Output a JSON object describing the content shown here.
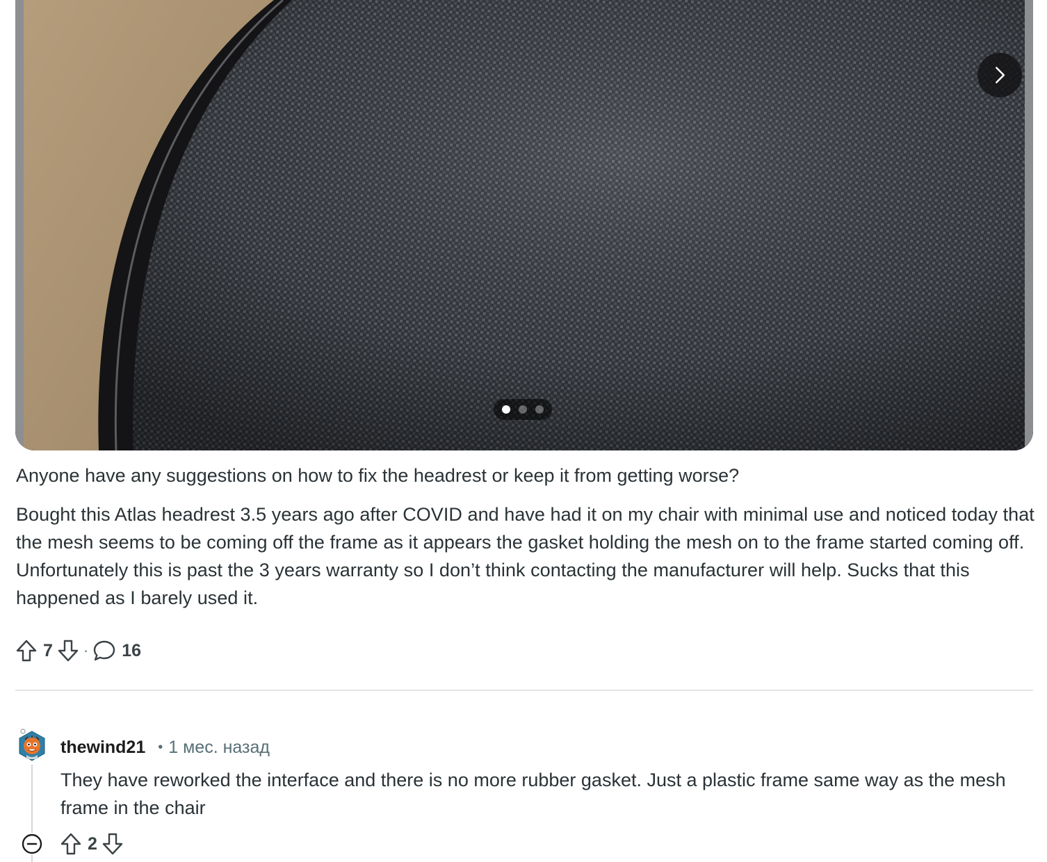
{
  "carousel": {
    "image_alt": "Close-up photo of a dark mesh headrest with its frame",
    "slide_count": 3,
    "active_slide": 1,
    "next_icon": "chevron-right-icon"
  },
  "post": {
    "title": "Anyone have any suggestions on how to fix the headrest or keep it from getting worse?",
    "body": "Bought this Atlas headrest 3.5 years ago after COVID and have had it on my chair with minimal use and noticed today that the mesh seems to be coming off the frame as it appears the gasket holding the mesh on to the frame started coming off. Unfortunately this is past the 3 years warranty so I don’t think contacting the manufacturer will help. Sucks that this happened as I barely used it.",
    "upvote_count": "7",
    "separator": "·",
    "comment_count": "16",
    "icons": {
      "upvote": "arrow-up-icon",
      "downvote": "arrow-down-icon",
      "comment": "speech-bubble-icon"
    }
  },
  "comment": {
    "username": "thewind21",
    "separator": "•",
    "timestamp": "1 мес. назад",
    "body": "They have reworked the interface and there is no more rubber gasket. Just a plastic frame same way as the mesh frame in the chair",
    "upvote_count": "2",
    "icons": {
      "collapse": "minus-circle-icon",
      "avatar": "avatar-icon"
    }
  },
  "colors": {
    "text": "#2a3236",
    "meta": "#576f76",
    "divider": "#e3e6e8",
    "mesh": "#3a3e44",
    "cardboard": "#b39a78"
  }
}
